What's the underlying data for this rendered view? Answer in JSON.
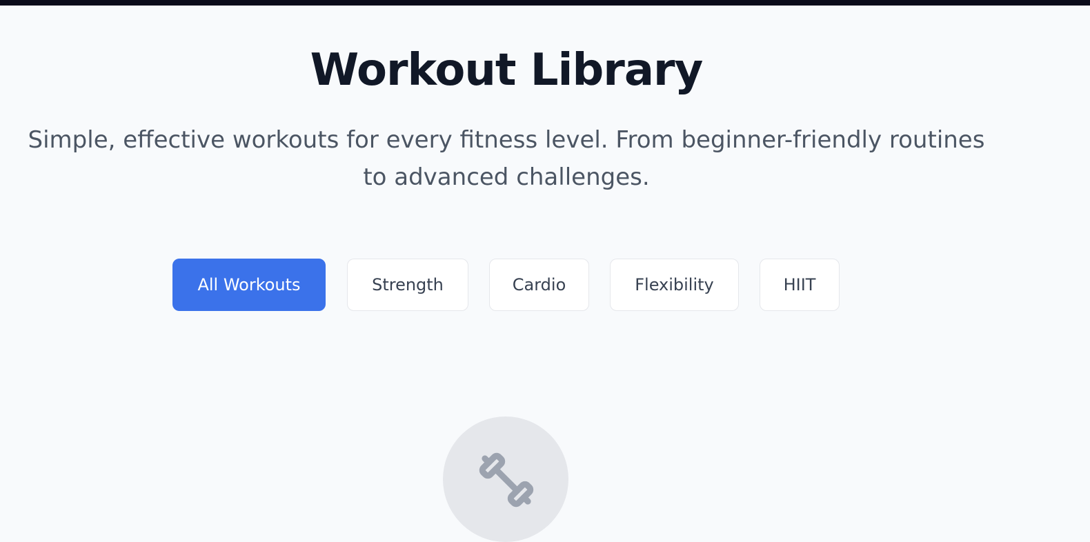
{
  "header": {
    "title": "Workout Library",
    "subtitle_line1": "Simple, effective workouts for every fitness level. From beginner-friendly routines",
    "subtitle_line2": "to advanced challenges."
  },
  "filters": {
    "options": [
      {
        "label": "All Workouts",
        "active": true
      },
      {
        "label": "Strength",
        "active": false
      },
      {
        "label": "Cardio",
        "active": false
      },
      {
        "label": "Flexibility",
        "active": false
      },
      {
        "label": "HIIT",
        "active": false
      }
    ]
  },
  "empty_state": {
    "icon": "dumbbell-icon"
  },
  "colors": {
    "background": "#f8fafc",
    "accent": "#3b72ea",
    "title": "#111827",
    "subtitle": "#4b5563",
    "top_bar": "#0b0b1a"
  }
}
